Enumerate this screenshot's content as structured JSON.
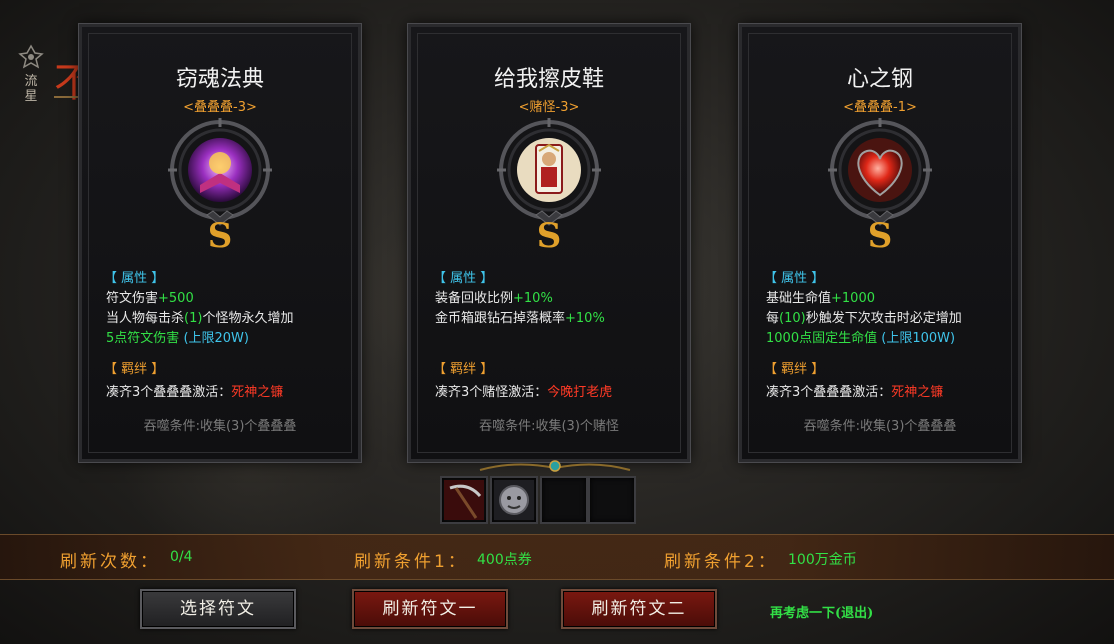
{
  "side": {
    "label_top": "流",
    "label_bottom": "星",
    "red_glyph": "不"
  },
  "cards": [
    {
      "title": "窃魂法典",
      "tag": "<叠叠叠-3>",
      "grade": "S",
      "attr_header": "【 属性 】",
      "attr_lines": [
        {
          "text": "符文伤害",
          "value": "+500"
        },
        {
          "text": "当人物每击杀",
          "value": "(1)",
          "text2": "个怪物永久增加"
        },
        {
          "value": "5",
          "text": "点符文伤害",
          "cap": "(上限20W)"
        }
      ],
      "bond_header": "【 羁绊 】",
      "bond_text": "凑齐3个叠叠叠激活：",
      "bond_name": "死神之镰",
      "condition": "吞噬条件:收集(3)个叠叠叠"
    },
    {
      "title": "给我擦皮鞋",
      "tag": "<赌怪-3>",
      "grade": "S",
      "attr_header": "【 属性 】",
      "attr_lines": [
        {
          "text": "装备回收比例",
          "value": "+10%"
        },
        {
          "text": "金币箱跟钻石掉落概率",
          "value": "+10%"
        }
      ],
      "bond_header": "【 羁绊 】",
      "bond_text": "凑齐3个赌怪激活：",
      "bond_name": "今晚打老虎",
      "condition": "吞噬条件:收集(3)个赌怪"
    },
    {
      "title": "心之钢",
      "tag": "<叠叠叠-1>",
      "grade": "S",
      "attr_header": "【 属性 】",
      "attr_lines": [
        {
          "text": "基础生命值",
          "value": "+1000"
        },
        {
          "text": "每",
          "value": "(10)",
          "text2": "秒触发下次攻击时必定增加"
        },
        {
          "value": "1000",
          "text": "点固定生命值",
          "cap": "(上限100W)"
        }
      ],
      "bond_header": "【 羁绊 】",
      "bond_text": "凑齐3个叠叠叠激活：",
      "bond_name": "死神之镰",
      "condition": "吞噬条件:收集(3)个叠叠叠"
    }
  ],
  "slots": [
    "scythe-icon",
    "tiger-icon",
    "empty",
    "empty"
  ],
  "bar": {
    "refresh_count_label": "刷新次数：",
    "refresh_count_value": "0/4",
    "cond1_label": "刷新条件1：",
    "cond1_value": "400点券",
    "cond2_label": "刷新条件2：",
    "cond2_value": "100万金币"
  },
  "buttons": {
    "select": "选择符文",
    "refresh1": "刷新符文一",
    "refresh2": "刷新符文二",
    "exit": "再考虑一下(退出)"
  },
  "colors": {
    "green": "#32e046",
    "orange": "#f0a030",
    "cyan": "#3fc4ea",
    "red": "#ff3a26"
  }
}
